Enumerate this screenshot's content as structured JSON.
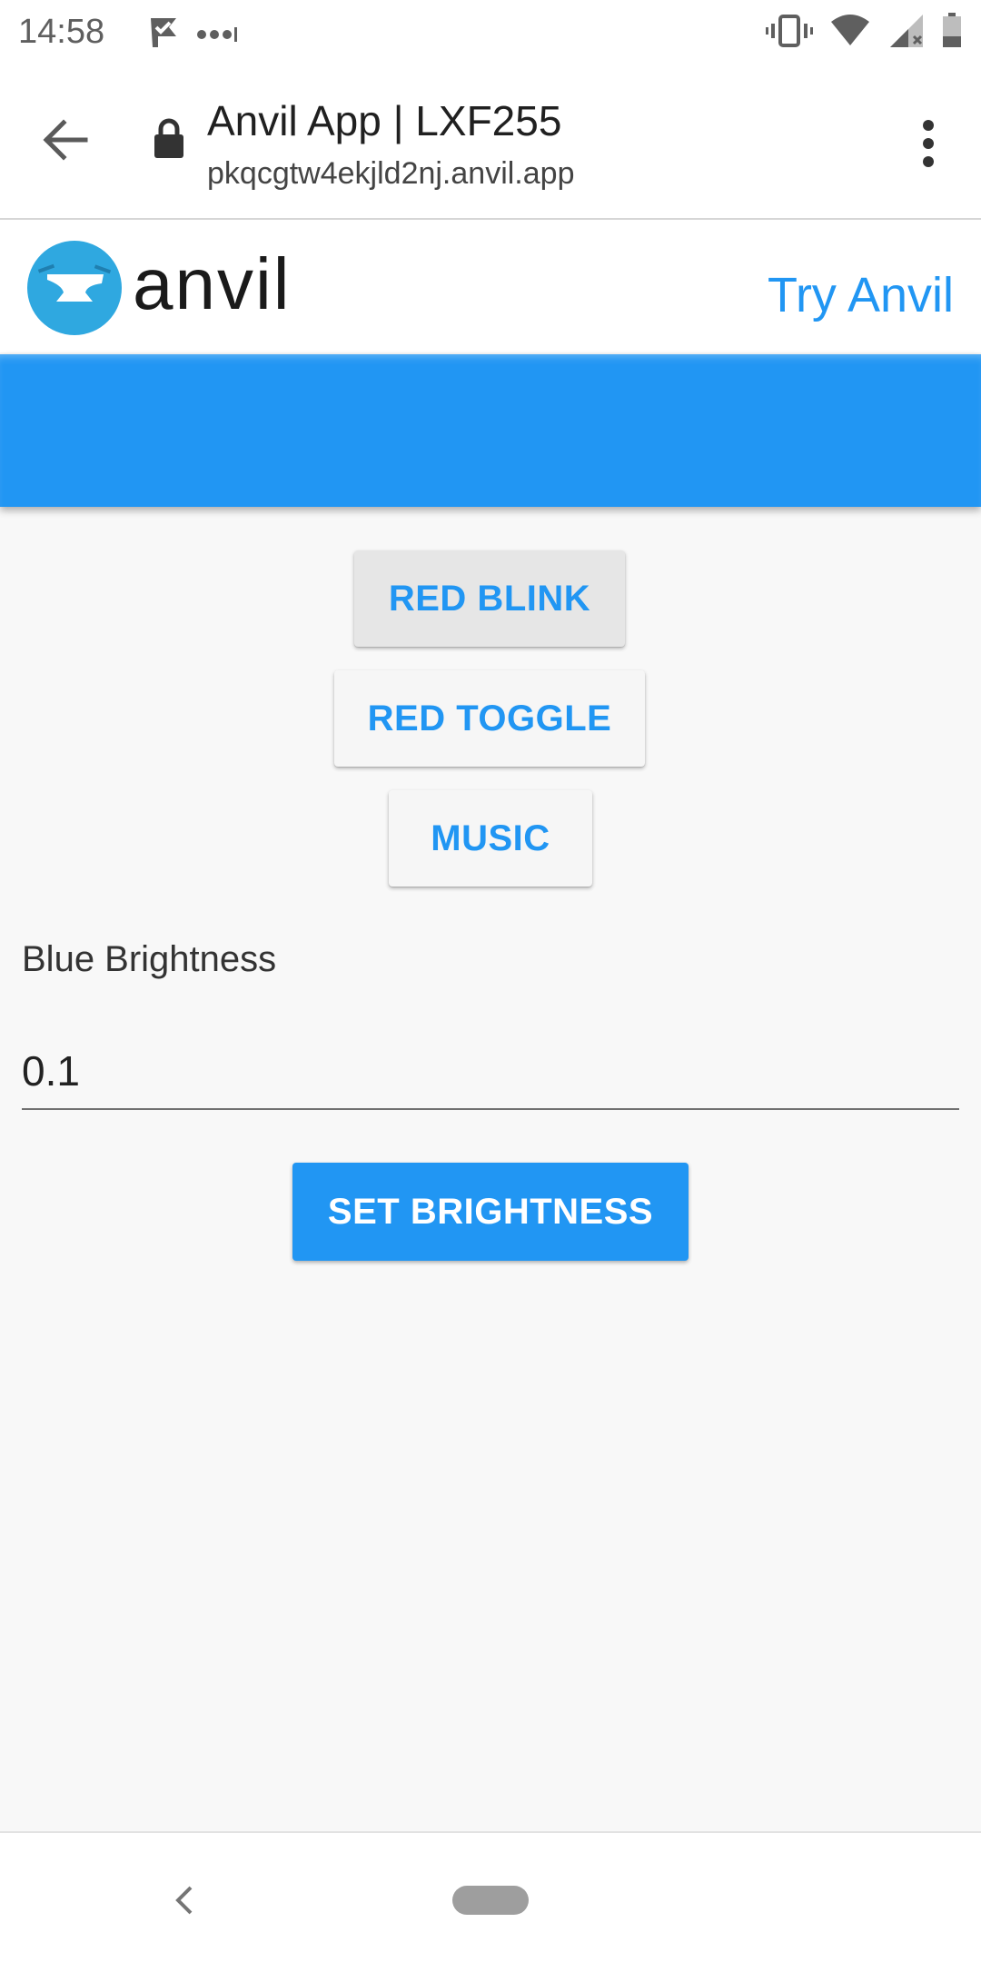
{
  "status_bar": {
    "time": "14:58",
    "icons": [
      "check-flag-icon",
      "more-dots-icon",
      "vibrate-icon",
      "wifi-icon",
      "signal-icon",
      "battery-icon"
    ]
  },
  "browser": {
    "title": "Anvil App | LXF255",
    "url": "pkqcgtw4ekjld2nj.anvil.app",
    "icons": [
      "back-arrow-icon",
      "lock-icon",
      "overflow-menu-icon"
    ]
  },
  "header": {
    "logo_text": "anvil",
    "try_link": "Try Anvil"
  },
  "buttons": {
    "red_blink": "RED BLINK",
    "red_toggle": "RED TOGGLE",
    "music": "MUSIC"
  },
  "brightness": {
    "label": "Blue Brightness",
    "value": "0.1",
    "set_button": "SET BRIGHTNESS"
  },
  "colors": {
    "accent": "#2196f3",
    "background": "#f8f8f8"
  }
}
